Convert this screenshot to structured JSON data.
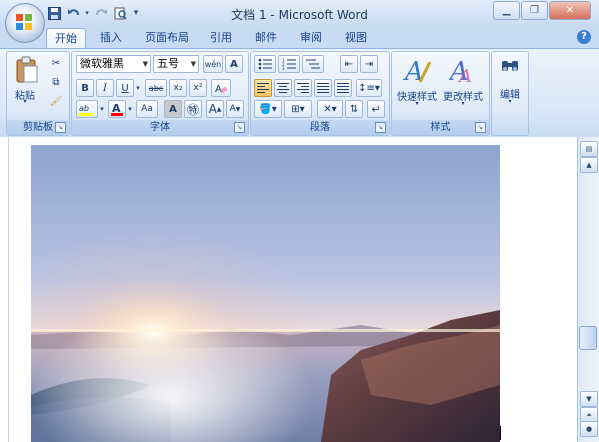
{
  "window": {
    "title": "文档 1 - Microsoft Word"
  },
  "qat": {
    "save": "save-icon",
    "undo": "undo-icon",
    "redo": "redo-icon",
    "print_preview": "print-preview-icon",
    "customize": "▾"
  },
  "tabs": [
    {
      "label": "开始",
      "active": true
    },
    {
      "label": "插入"
    },
    {
      "label": "页面布局"
    },
    {
      "label": "引用"
    },
    {
      "label": "邮件"
    },
    {
      "label": "审阅"
    },
    {
      "label": "视图"
    }
  ],
  "help": "?",
  "clipboard": {
    "paste_label": "粘贴",
    "group_label": "剪贴板"
  },
  "font": {
    "family": "微软雅黑",
    "size": "五号",
    "group_label": "字体",
    "grow": "A",
    "shrink": "A",
    "bold": "B",
    "italic": "I",
    "underline": "U",
    "strike": "abc",
    "subscript": "x₂",
    "superscript": "x²",
    "change_case": "Aa",
    "phonetic": "wén"
  },
  "paragraph": {
    "group_label": "段落"
  },
  "styles": {
    "quick_styles_label": "快速样式",
    "change_styles_label": "更改样式",
    "group_label": "样式"
  },
  "editing": {
    "label": "编辑"
  },
  "colors": {
    "ribbon_text": "#15428b",
    "highlight": "#ffff00",
    "font_color": "#ff0000",
    "accent": "#3b7fd1"
  }
}
